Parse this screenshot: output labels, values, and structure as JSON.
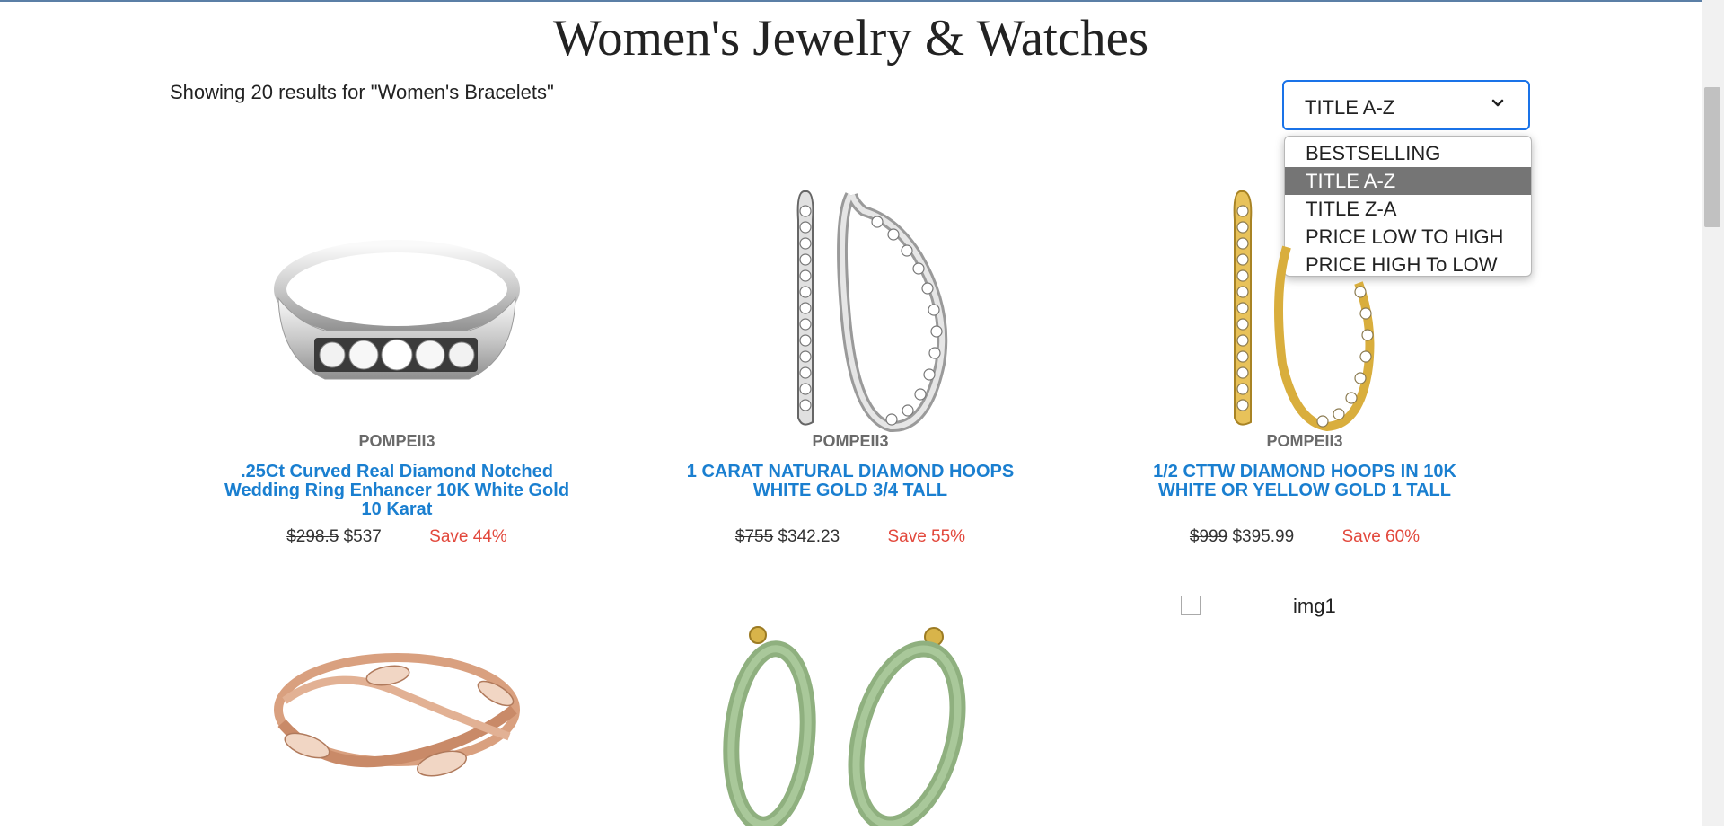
{
  "page": {
    "title": "Women's Jewelry & Watches"
  },
  "results": {
    "summary": "Showing 20 results for \"Women's Bracelets\""
  },
  "sort": {
    "selected": "TITLE A-Z",
    "options": [
      "BESTSELLING",
      "TITLE A-Z",
      "TITLE Z-A",
      "PRICE LOW TO HIGH",
      "PRICE HIGH To LOW"
    ]
  },
  "products": [
    {
      "brand": "POMPEII3",
      "title": ".25Ct Curved Real Diamond Notched Wedding Ring Enhancer 10K White Gold 10 Karat",
      "old_price": "$298.5",
      "price": "$537",
      "save": "Save 44%"
    },
    {
      "brand": "POMPEII3",
      "title": "1 CARAT NATURAL DIAMOND HOOPS WHITE GOLD 3/4 TALL",
      "old_price": "$755",
      "price": "$342.23",
      "save": "Save 55%"
    },
    {
      "brand": "POMPEII3",
      "title": "1/2 CTTW DIAMOND HOOPS IN 10K WHITE OR YELLOW GOLD 1 TALL",
      "old_price": "$999",
      "price": "$395.99",
      "save": "Save 60%"
    }
  ],
  "broken_image": {
    "alt": "img1"
  },
  "icons": {
    "sort_chevron": "chevron-down-icon"
  },
  "colors": {
    "accent": "#1a73e8",
    "link": "#1a7fd0",
    "save": "#e2483c",
    "selected_option": "#757575"
  }
}
